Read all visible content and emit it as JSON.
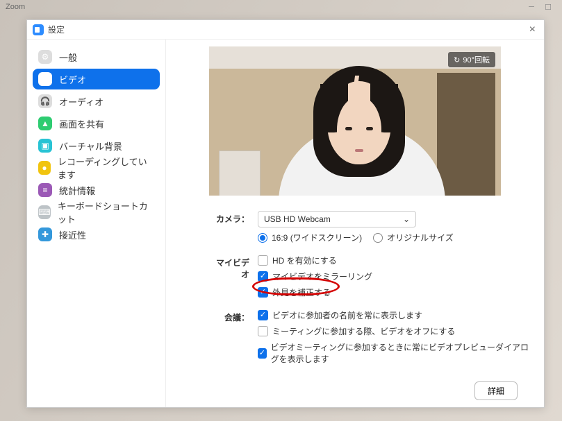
{
  "window": {
    "app_title": "Zoom"
  },
  "dialog": {
    "title": "設定"
  },
  "sidebar": {
    "items": [
      {
        "label": "一般"
      },
      {
        "label": "ビデオ"
      },
      {
        "label": "オーディオ"
      },
      {
        "label": "画面を共有"
      },
      {
        "label": "バーチャル背景"
      },
      {
        "label": "レコーディングしています"
      },
      {
        "label": "統計情報"
      },
      {
        "label": "キーボードショートカット"
      },
      {
        "label": "接近性"
      }
    ]
  },
  "preview": {
    "rotate_label": "90°回転"
  },
  "form": {
    "camera_label": "カメラ：",
    "camera_value": "USB HD Webcam",
    "aspect_wide": "16:9 (ワイドスクリーン)",
    "aspect_original": "オリジナルサイズ",
    "myvideo_label": "マイビデオ",
    "opt_hd": "HD を有効にする",
    "opt_mirror": "マイビデオをミラーリング",
    "opt_touchup": "外見を補正する",
    "meeting_label": "会議：",
    "opt_names": "ビデオに参加者の名前を常に表示します",
    "opt_offjoin": "ミーティングに参加する際、ビデオをオフにする",
    "opt_previewdlg": "ビデオミーティングに参加するときに常にビデオプレビューダイアログを表示します"
  },
  "footer": {
    "advanced": "詳細"
  }
}
